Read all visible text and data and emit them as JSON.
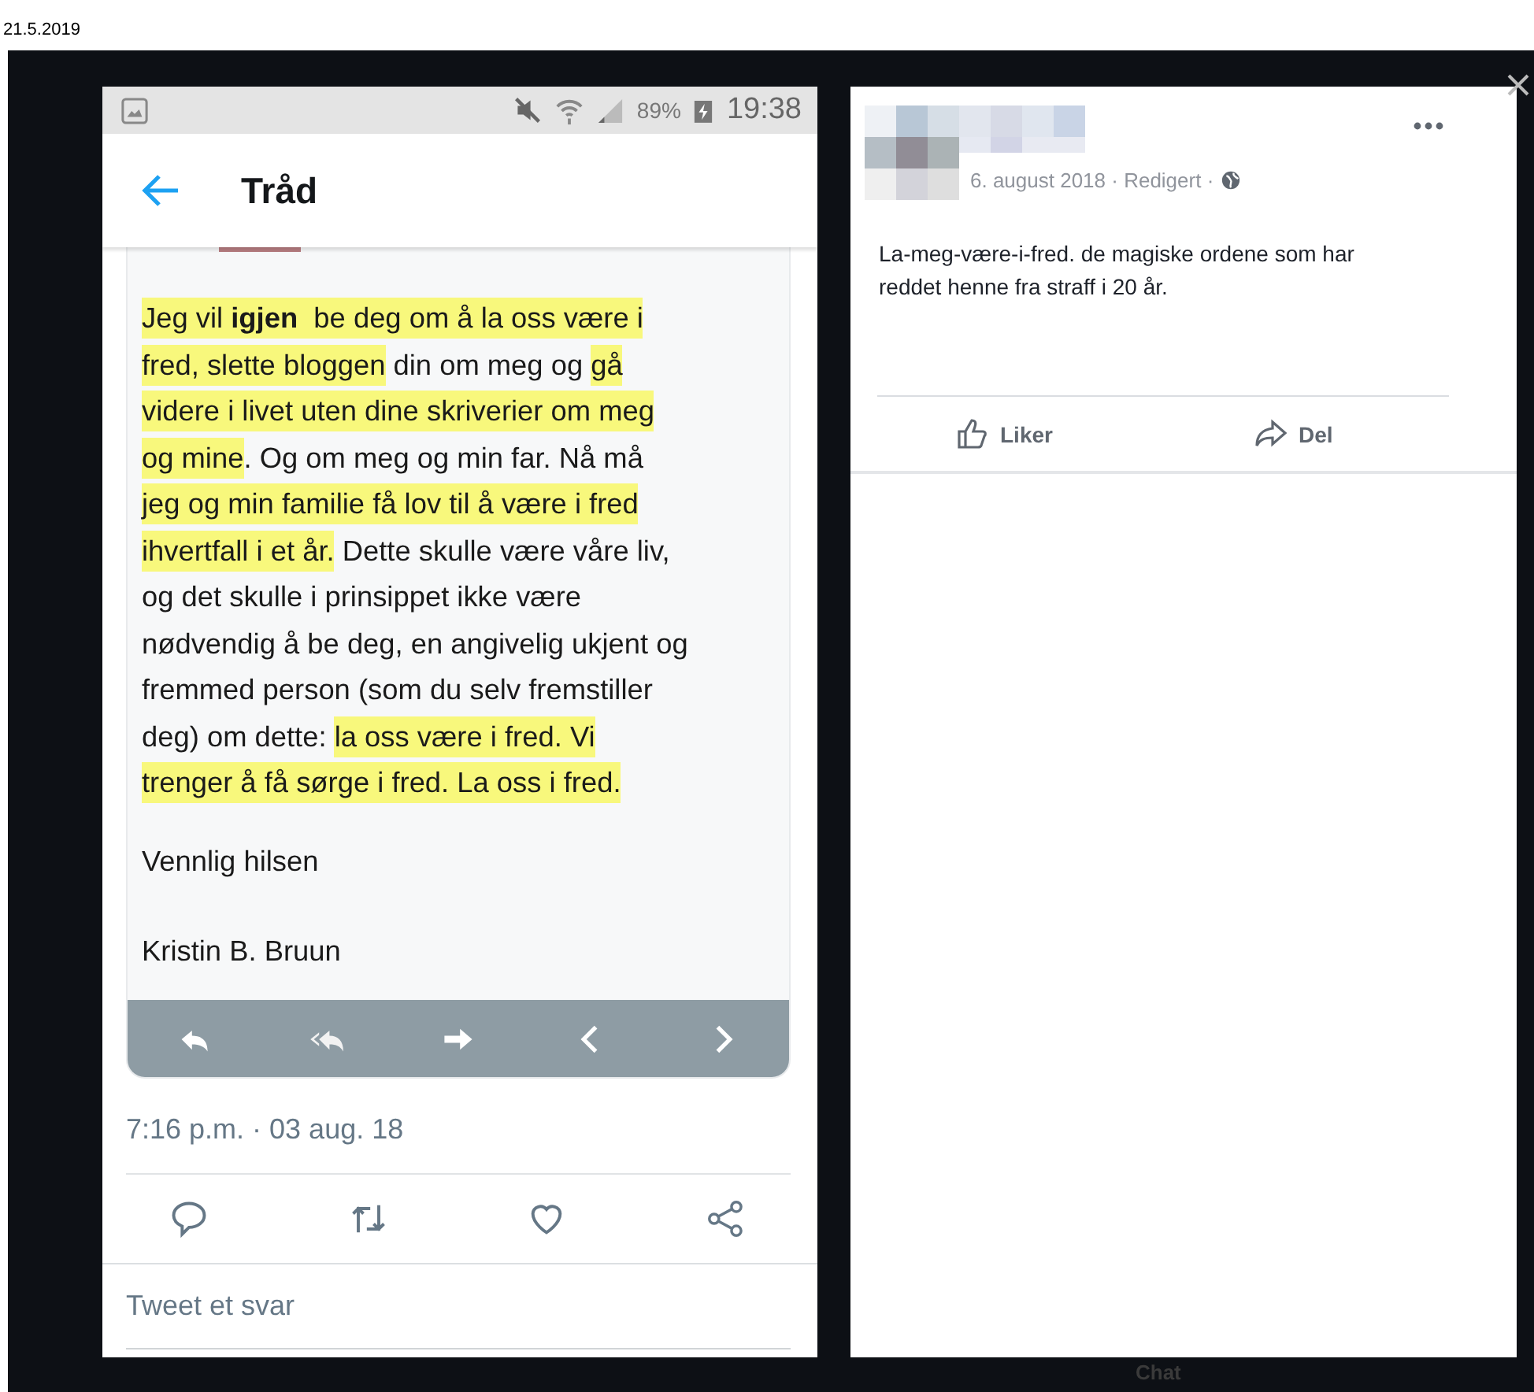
{
  "page_header": {
    "date": "21.5.2019"
  },
  "tweet_screenshot": {
    "status_bar": {
      "battery": "89%",
      "time": "19:38"
    },
    "header": {
      "title": "Tråd"
    },
    "letter": {
      "lines": [
        {
          "segments": [
            {
              "text": "Jeg vil **igjen**  be deg om å la oss være i",
              "highlighted": true
            }
          ]
        },
        {
          "segments": [
            {
              "text": "fred, slette bloggen",
              "highlighted": true
            },
            {
              "text": " din om meg og ",
              "highlighted": false
            },
            {
              "text": "gå",
              "highlighted": true
            }
          ]
        },
        {
          "segments": [
            {
              "text": "videre i livet uten dine skriverier om meg",
              "highlighted": true
            }
          ]
        },
        {
          "segments": [
            {
              "text": "og mine",
              "highlighted": true
            },
            {
              "text": ". Og om meg og min far. Nå må",
              "highlighted": false
            }
          ]
        },
        {
          "segments": [
            {
              "text": "jeg og min familie få lov til å være i fred",
              "highlighted": true
            }
          ]
        },
        {
          "segments": [
            {
              "text": "ihvertfall i et år.",
              "highlighted": true
            },
            {
              "text": " Dette skulle være våre liv,",
              "highlighted": false
            }
          ]
        },
        {
          "segments": [
            {
              "text": "og det skulle i prinsippet ikke være",
              "highlighted": false
            }
          ]
        },
        {
          "segments": [
            {
              "text": "nødvendig å be deg, en angivelig ukjent og",
              "highlighted": false
            }
          ]
        },
        {
          "segments": [
            {
              "text": "fremmed person (som du selv fremstiller",
              "highlighted": false
            }
          ]
        },
        {
          "segments": [
            {
              "text": "deg) om dette: ",
              "highlighted": false
            },
            {
              "text": "la oss være i fred. Vi",
              "highlighted": true
            }
          ]
        },
        {
          "segments": [
            {
              "text": "trenger å få sørge i fred. La oss i fred.",
              "highlighted": true
            }
          ]
        }
      ],
      "closing": "Vennlig hilsen",
      "signature": "Kristin B. Bruun"
    },
    "timestamp": "7:16 p.m. · 03 aug. 18",
    "reply_field": {
      "placeholder": "Tweet et svar"
    }
  },
  "post": {
    "meta": "6. august 2018 · Redigert ·",
    "text": "La-meg-være-i-fred. de magiske ordene som har reddet henne fra straff i 20 år.",
    "actions": [
      {
        "kind": "like",
        "label": "Liker"
      },
      {
        "kind": "share",
        "label": "Del"
      }
    ]
  },
  "chat_bar": {
    "label": "Chat"
  }
}
